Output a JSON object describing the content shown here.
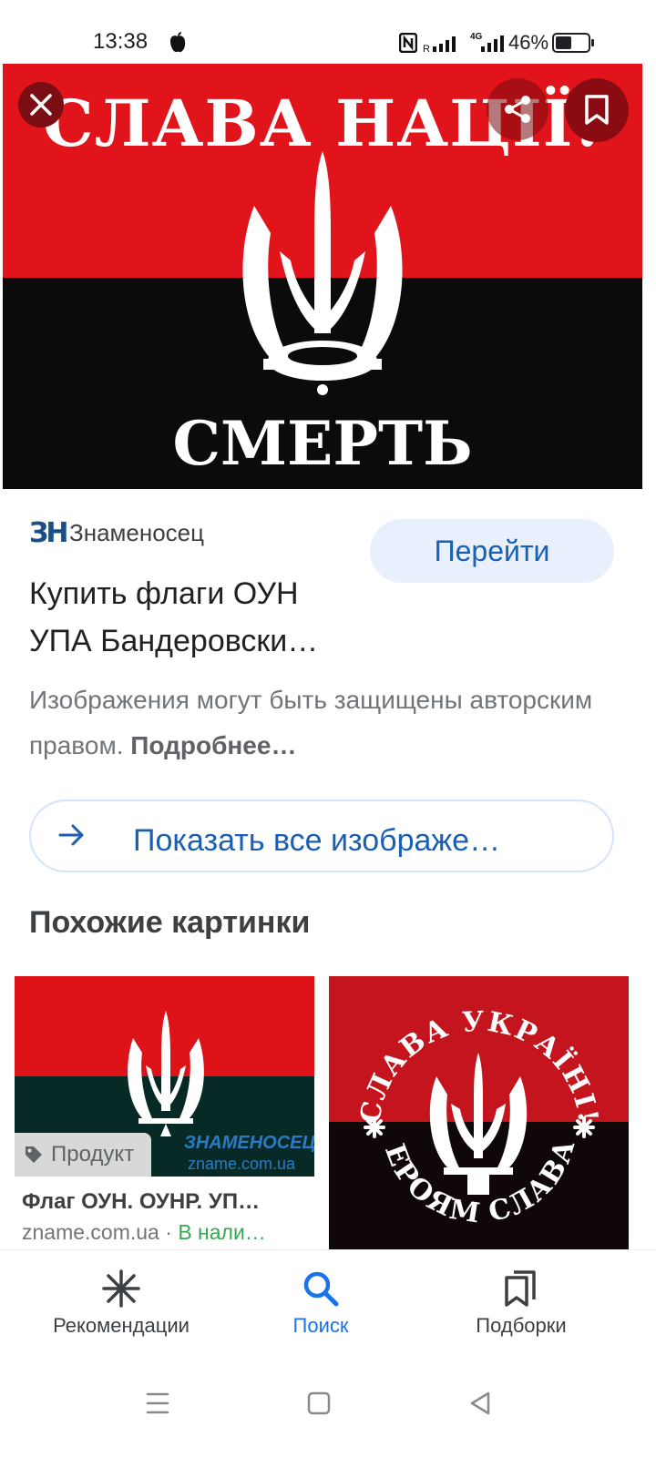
{
  "status": {
    "time": "13:38",
    "network": "4G",
    "battery": "46%",
    "battery_level": 0.46
  },
  "hero": {
    "top_text": "СЛАВА НАЦІЇ!",
    "bottom_text": "СМЕРТЬ ВОРОГАМ!",
    "colors": {
      "red": "#e2141b",
      "black": "#0b0b0b"
    }
  },
  "result": {
    "source_logo": "ЗН",
    "source_name": "Знаменосец",
    "goto_label": "Перейти",
    "title_line1": "Купить флаги ОУН",
    "title_line2": "УПА Бандеровски…",
    "copyright_text": "Изображения могут быть защищены авторским правом.",
    "copyright_more": "Подробнее…",
    "show_all_label": "Показать все изображе…"
  },
  "similar": {
    "heading": "Похожие картинки",
    "items": [
      {
        "badge": "Продукт",
        "title": "Флаг ОУН. ОУНР. УП…",
        "domain": "zname.com.ua",
        "separator": "·",
        "stock": "В нали…",
        "watermark_brand": "ЗНАМЕНОСЕЦ",
        "watermark_site": "zname.com.ua"
      },
      {
        "top_text": "СЛАВА УКРАЇНІ!",
        "bottom_text": "ГЕРОЯМ СЛАВА!"
      }
    ]
  },
  "bottom_nav": {
    "items": [
      {
        "label": "Рекомендации",
        "icon": "asterisk-icon"
      },
      {
        "label": "Поиск",
        "icon": "search-icon",
        "active": true
      },
      {
        "label": "Подборки",
        "icon": "collections-icon"
      }
    ],
    "active_color": "#1a73e8"
  }
}
